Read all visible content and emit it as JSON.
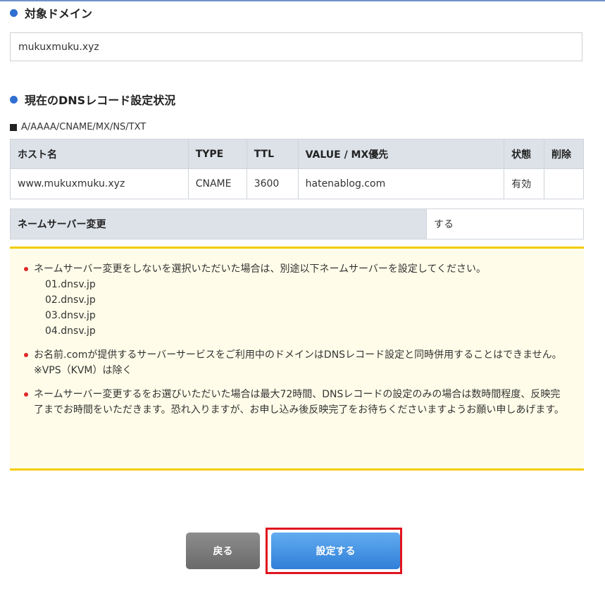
{
  "target_domain": {
    "title": "対象ドメイン",
    "value": "mukuxmuku.xyz"
  },
  "dns_status": {
    "title": "現在のDNSレコード設定状況",
    "record_types": "A/AAAA/CNAME/MX/NS/TXT",
    "columns": [
      "ホスト名",
      "TYPE",
      "TTL",
      "VALUE / MX優先",
      "状態",
      "削除"
    ],
    "rows": [
      [
        "www.mukuxmuku.xyz",
        "CNAME",
        "3600",
        "hatenablog.com",
        "有効",
        ""
      ]
    ]
  },
  "nameserver_change": {
    "label": "ネームサーバー変更",
    "value": "する"
  },
  "notice": {
    "item1": "ネームサーバー変更をしないを選択いただいた場合は、別途以下ネームサーバーを設定してください。",
    "nameservers": [
      "01.dnsv.jp",
      "02.dnsv.jp",
      "03.dnsv.jp",
      "04.dnsv.jp"
    ],
    "item2": "お名前.comが提供するサーバーサービスをご利用中のドメインはDNSレコード設定と同時併用することはできません。",
    "item2_note": "※VPS（KVM）は除く",
    "item3": "ネームサーバー変更するをお選びいただいた場合は最大72時間、DNSレコードの設定のみの場合は数時間程度、反映完了までお時間をいただきます。恐れ入りますが、お申し込み後反映完了をお待ちくださいますようお願い申しあげます。"
  },
  "buttons": {
    "back": "戻る",
    "submit": "設定する"
  },
  "colors": {
    "accent_blue": "#2f6fd1",
    "notice_border": "#f2cb00",
    "highlight_red": "#e0141e"
  }
}
